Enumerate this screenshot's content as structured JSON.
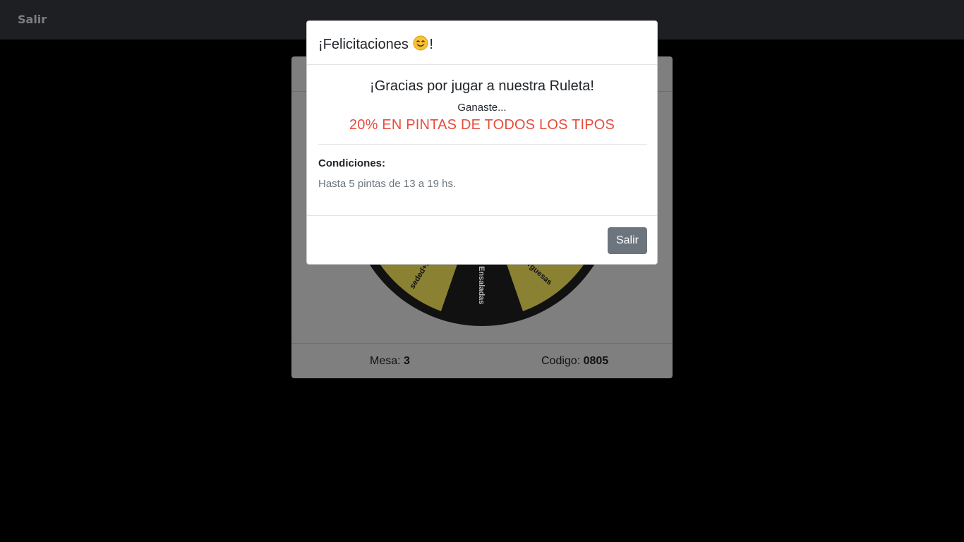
{
  "navbar": {
    "link_label": "Salir"
  },
  "card": {
    "footer": {
      "mesa_label": "Mesa:",
      "mesa_value": "3",
      "codigo_label": "Codigo:",
      "codigo_value": "0805"
    },
    "wheel": {
      "segments": [
        {
          "label": "Ensaladas",
          "color": "#111111"
        },
        {
          "label": "sedeɗ+s",
          "color": "#8a8133"
        },
        {
          "label": "rguesas",
          "color": "#8a8133"
        }
      ]
    }
  },
  "modal": {
    "title_pre": "¡Felicitaciones",
    "title_post": "!",
    "title_icon": "smiling-face-emoji",
    "thanks": "¡Gracias por jugar a nuestra Ruleta!",
    "ganaste": "Ganaste...",
    "prize": "20% EN PINTAS DE TODOS LOS TIPOS",
    "conditions_label": "Condiciones:",
    "conditions_text": "Hasta 5 pintas de 13 a 19 hs.",
    "button_label": "Salir"
  },
  "colors": {
    "prize": "#e74c3c",
    "button": "#6c757d",
    "navbar": "#1d1f22",
    "backdrop": "#000000"
  }
}
